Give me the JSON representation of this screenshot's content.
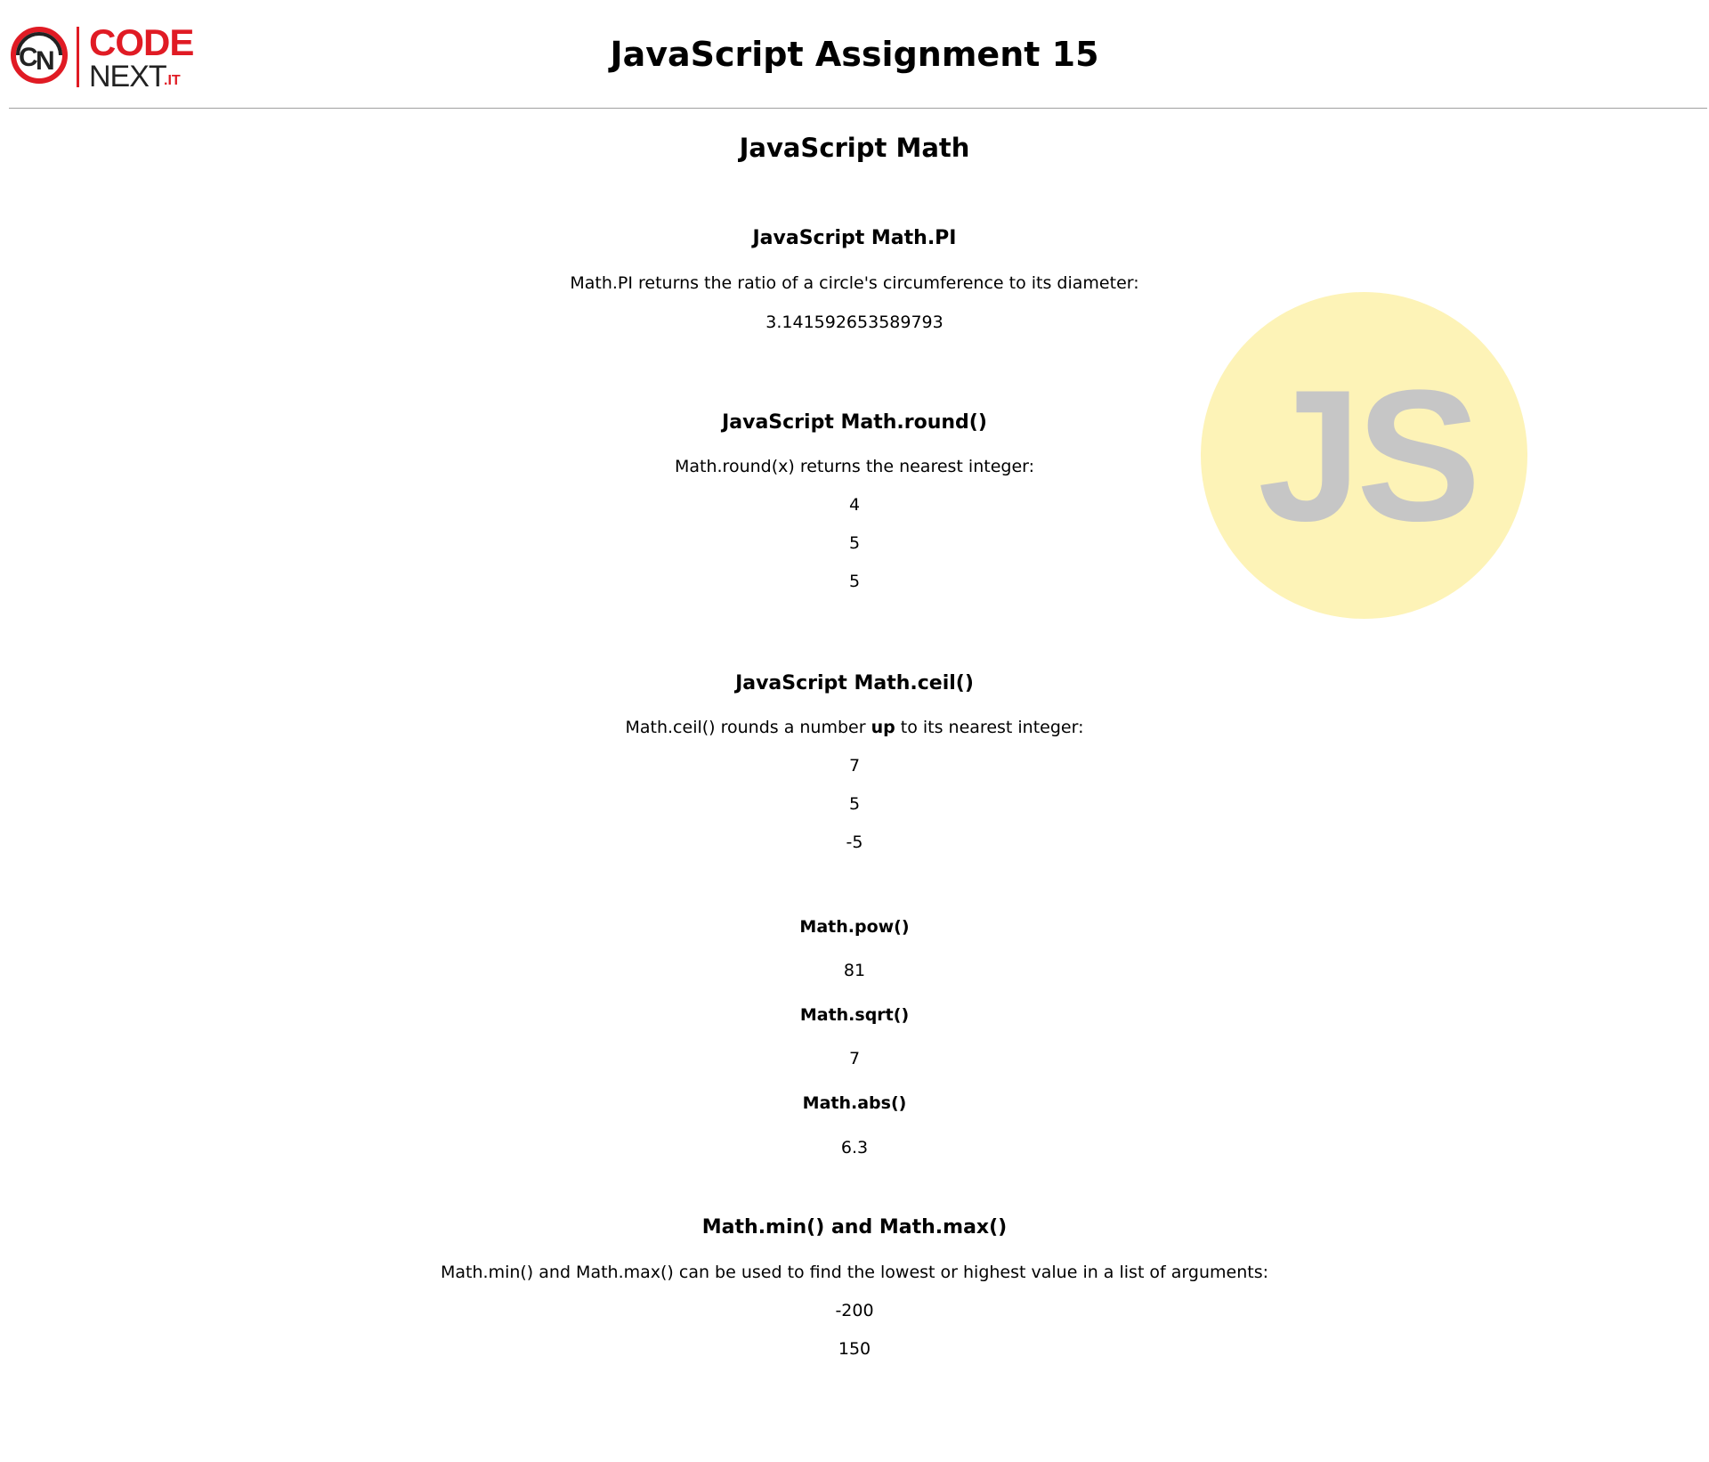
{
  "header": {
    "logo": {
      "code": "CODE",
      "next": "NEXT",
      "suffix": ".IT"
    },
    "title": "JavaScript Assignment 15"
  },
  "badge": {
    "text": "JS",
    "background_color": "#fdf3b7",
    "text_color": "#c6c6c6"
  },
  "main": {
    "heading": "JavaScript Math",
    "pi_section": {
      "title": "JavaScript Math.PI",
      "description": "Math.PI returns the ratio of a circle's circumference to its diameter:",
      "result": "3.141592653589793"
    },
    "round_section": {
      "title": "JavaScript Math.round()",
      "description": "Math.round(x) returns the nearest integer:",
      "results": [
        "4",
        "5",
        "5"
      ]
    },
    "ceil_section": {
      "title": "JavaScript Math.ceil()",
      "description_prefix": "Math.ceil() rounds a number ",
      "description_emphasis": "up",
      "description_suffix": " to its nearest integer:",
      "results": [
        "7",
        "5",
        "-5"
      ]
    },
    "pow_section": {
      "label": "Math.pow()",
      "result": "81"
    },
    "sqrt_section": {
      "label": "Math.sqrt()",
      "result": "7"
    },
    "abs_section": {
      "label": "Math.abs()",
      "result": "6.3"
    },
    "minmax_section": {
      "title": "Math.min() and Math.max()",
      "description": "Math.min() and Math.max() can be used to find the lowest or highest value in a list of arguments:",
      "results": [
        "-200",
        "150"
      ]
    }
  },
  "colors": {
    "brand_red": "#e01b24",
    "divider": "#a0a0a0"
  }
}
